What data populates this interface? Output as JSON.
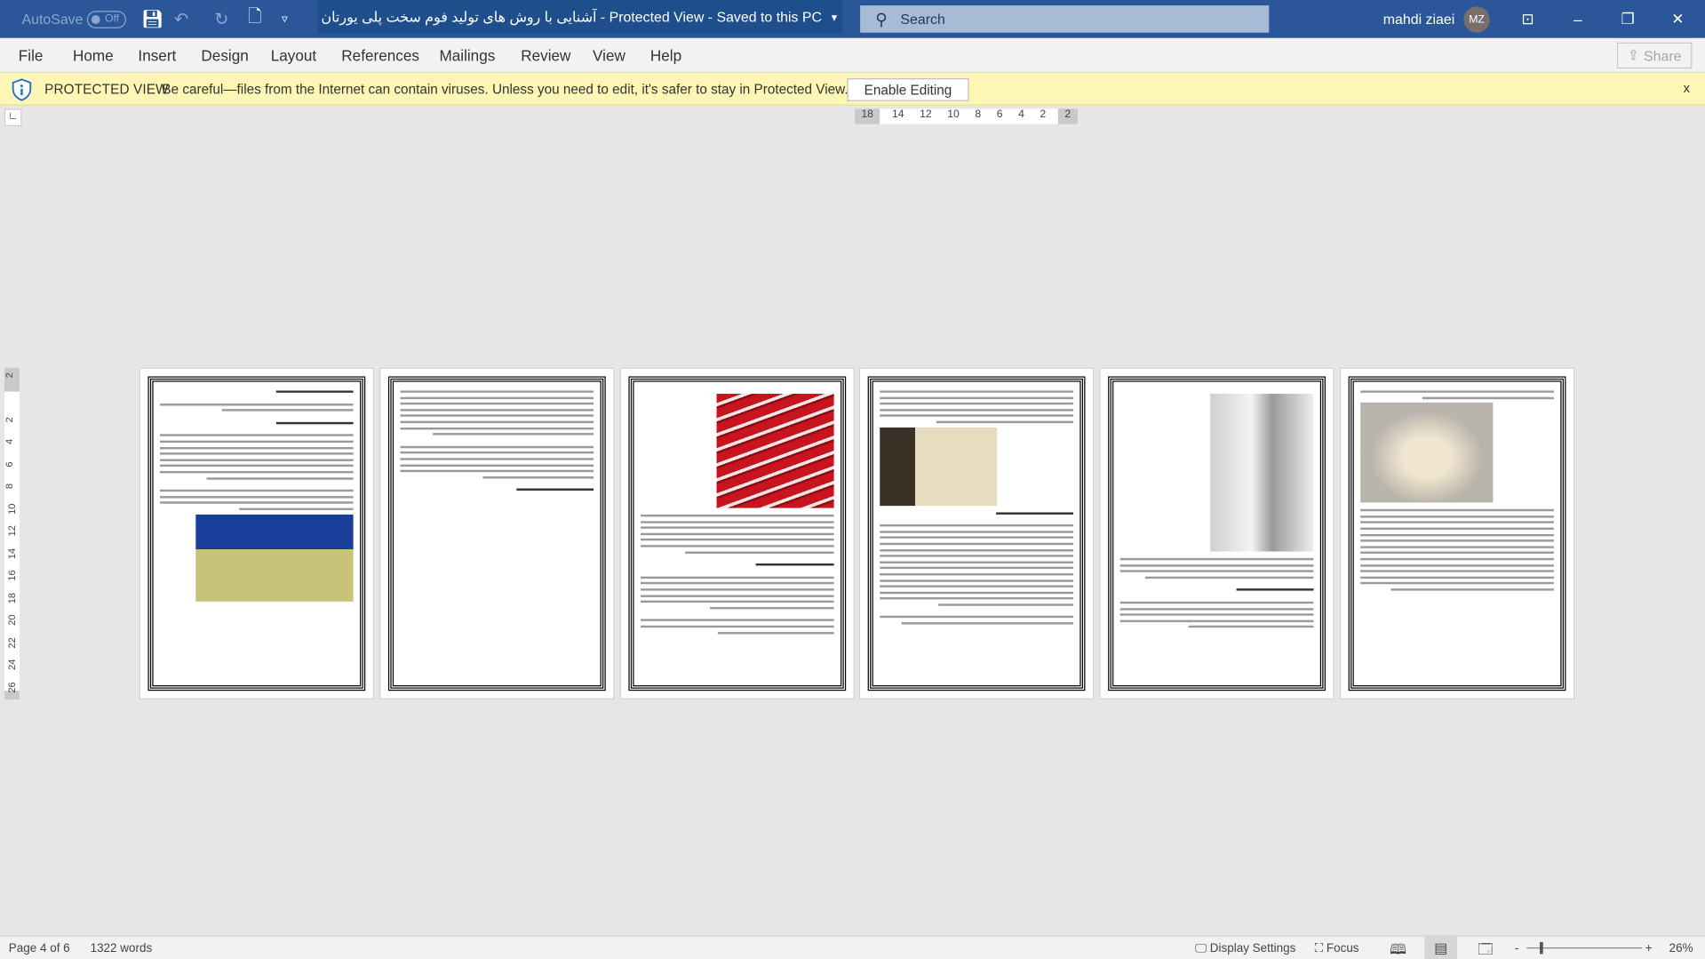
{
  "titlebar": {
    "autosave_label": "AutoSave",
    "autosave_state": "Off",
    "doc_title": "آشنایی با روش های تولید فوم سخت پلی یورتان",
    "mode": "Protected View",
    "save_status": "Saved to this PC",
    "search_placeholder": "Search",
    "user_name": "mahdi ziaei",
    "user_initials": "MZ",
    "accent": "#2b579a"
  },
  "ribbon": {
    "tabs": [
      "File",
      "Home",
      "Insert",
      "Design",
      "Layout",
      "References",
      "Mailings",
      "Review",
      "View",
      "Help"
    ],
    "share_label": "Share"
  },
  "protected_view": {
    "label": "PROTECTED VIEW",
    "message": "Be careful—files from the Internet can contain viruses. Unless you need to edit, it's safer to stay in Protected View.",
    "enable_button": "Enable Editing",
    "close": "x",
    "bg": "#fdf6b4"
  },
  "ruler": {
    "left": "18",
    "ticks": [
      "14",
      "12",
      "10",
      "8",
      "6",
      "4",
      "2"
    ],
    "right": "2"
  },
  "vruler": {
    "ticks": [
      "2",
      "2",
      "4",
      "6",
      "8",
      "10",
      "12",
      "14",
      "16",
      "18",
      "20",
      "22",
      "24",
      "26"
    ]
  },
  "pages": [
    {
      "number": 1,
      "image": "warehouse-foam-blocks"
    },
    {
      "number": 2,
      "image": ""
    },
    {
      "number": 3,
      "image": "red-sandwich-panels"
    },
    {
      "number": 4,
      "image": "spray-foam-worker"
    },
    {
      "number": 5,
      "image": "foam-wall-section"
    },
    {
      "number": 6,
      "image": "foam-carved-furniture-leg"
    }
  ],
  "status": {
    "page": "Page 4 of 6",
    "words": "1322 words",
    "display_settings": "Display Settings",
    "focus": "Focus",
    "zoom": "26%",
    "zoom_minus": "-",
    "zoom_plus": "+"
  }
}
